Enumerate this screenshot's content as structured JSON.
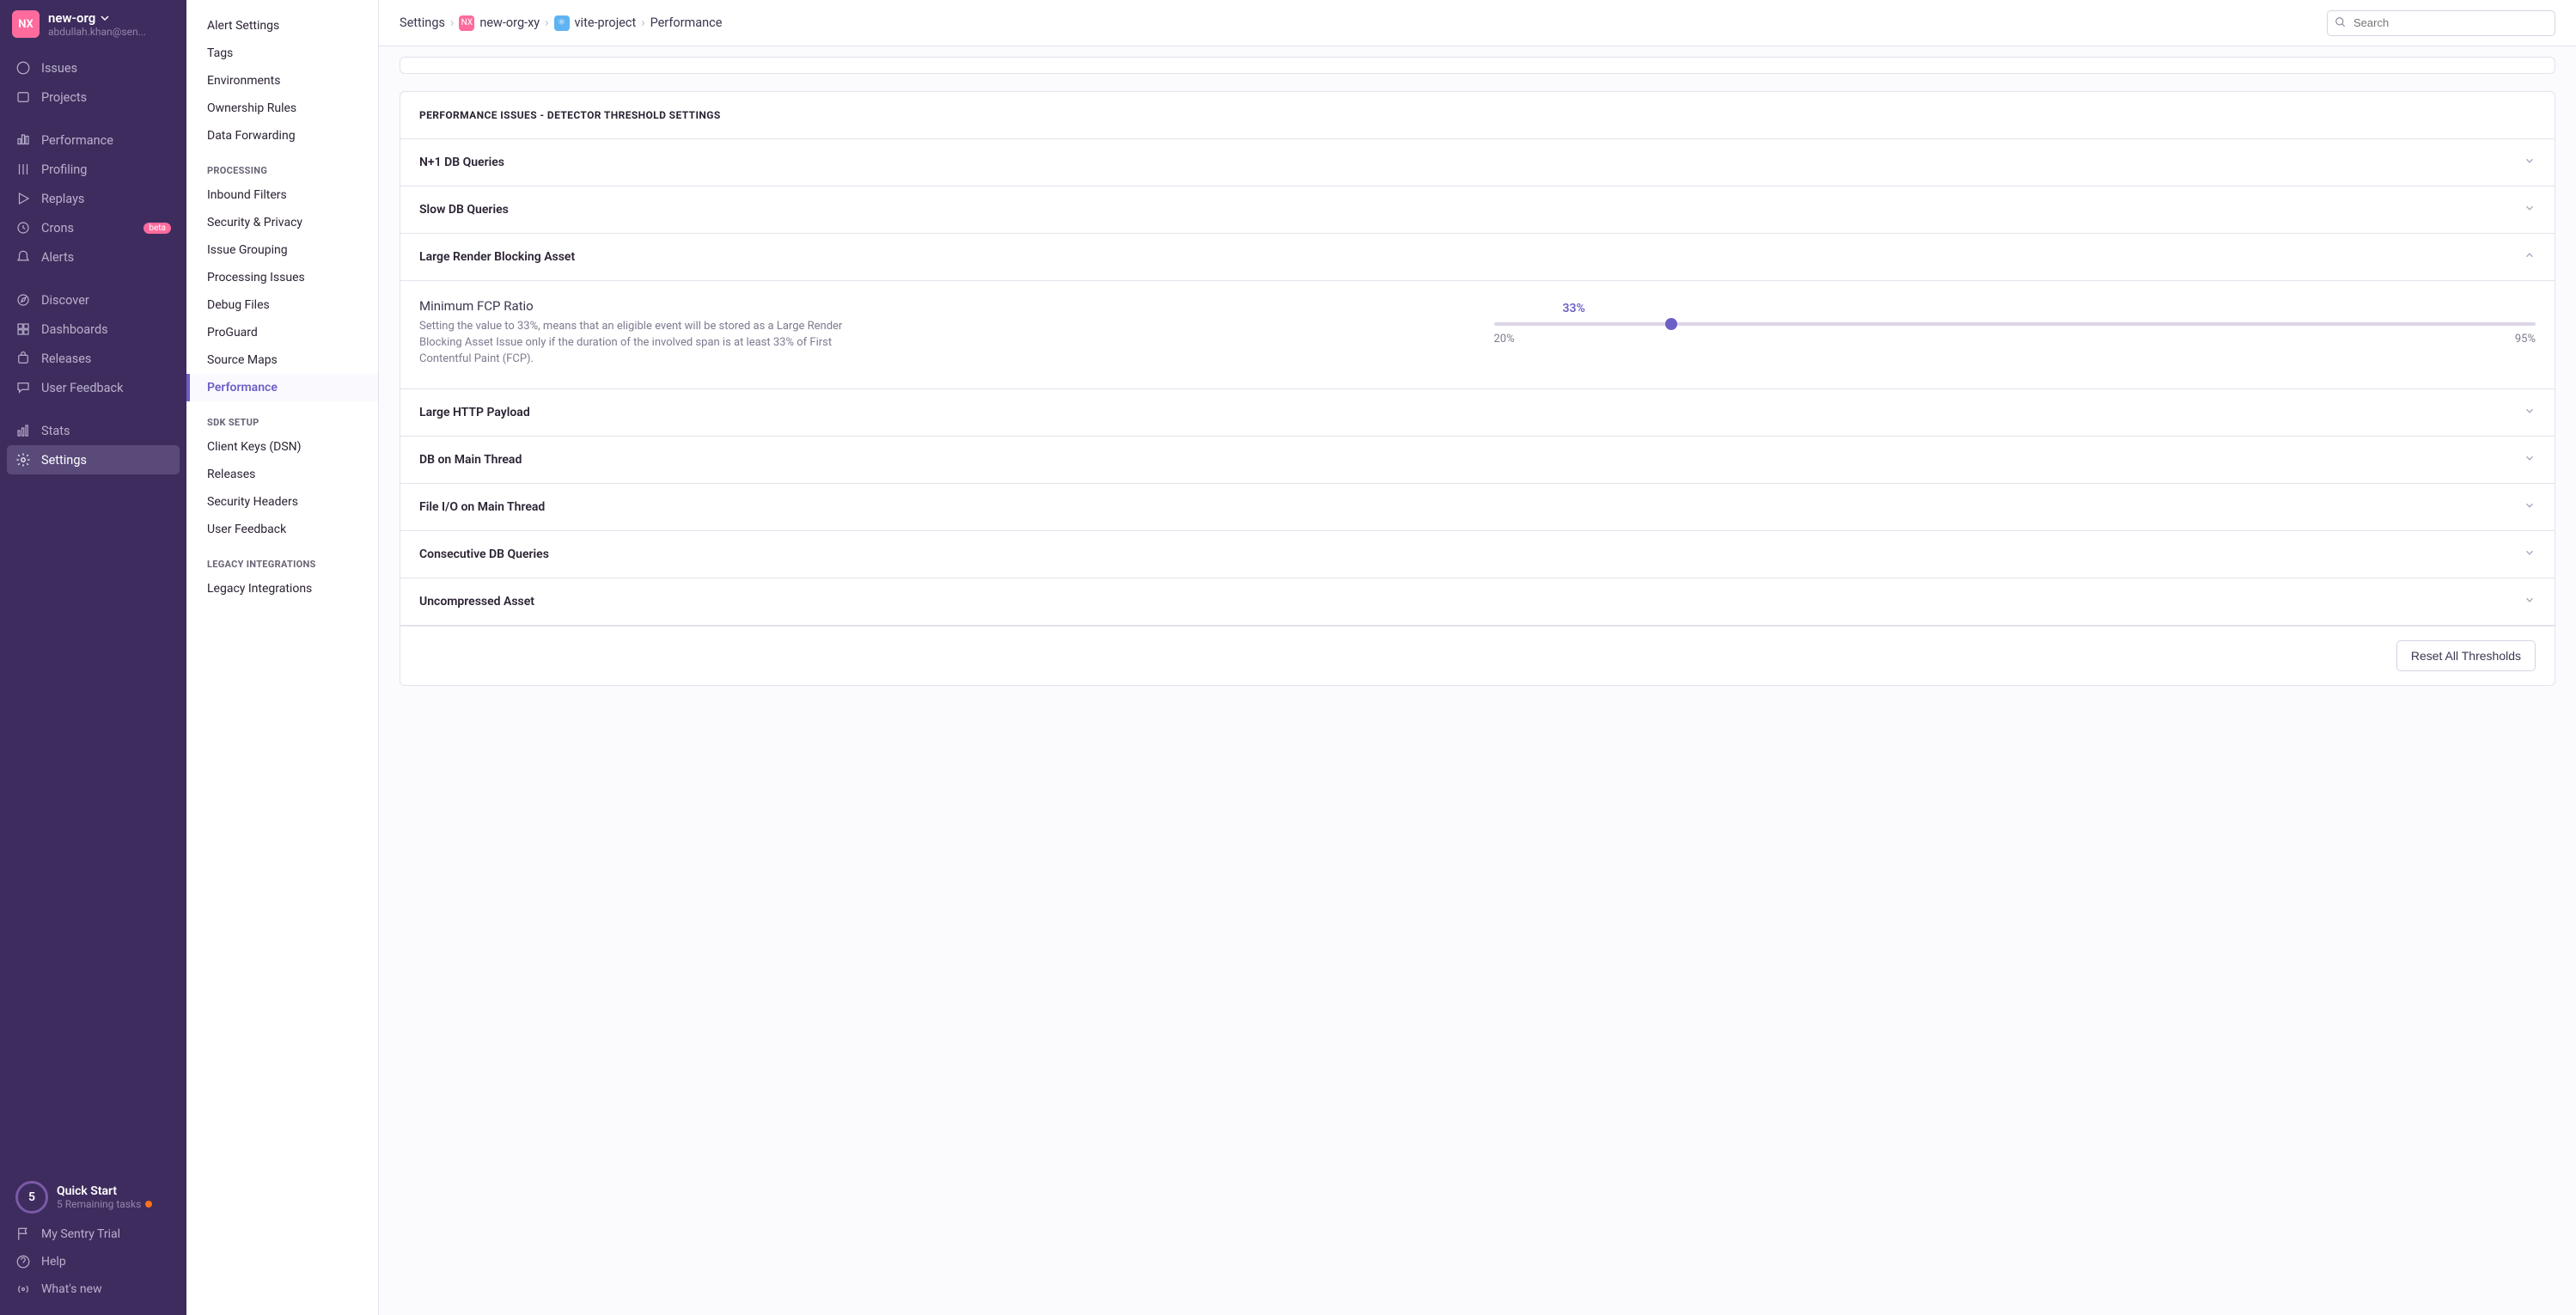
{
  "org": {
    "avatar": "NX",
    "name": "new-org",
    "email": "abdullah.khan@sen..."
  },
  "sidebar": {
    "items": [
      {
        "label": "Issues"
      },
      {
        "label": "Projects"
      },
      {
        "label": "Performance"
      },
      {
        "label": "Profiling"
      },
      {
        "label": "Replays"
      },
      {
        "label": "Crons"
      },
      {
        "label": "Alerts"
      },
      {
        "label": "Discover"
      },
      {
        "label": "Dashboards"
      },
      {
        "label": "Releases"
      },
      {
        "label": "User Feedback"
      },
      {
        "label": "Stats"
      },
      {
        "label": "Settings"
      }
    ],
    "beta": "beta",
    "quick": {
      "count": "5",
      "title": "Quick Start",
      "sub": "5 Remaining tasks"
    },
    "bottom": [
      {
        "label": "My Sentry Trial"
      },
      {
        "label": "Help"
      },
      {
        "label": "What's new"
      }
    ]
  },
  "secondary": {
    "top": [
      {
        "label": "Alert Settings"
      },
      {
        "label": "Tags"
      },
      {
        "label": "Environments"
      },
      {
        "label": "Ownership Rules"
      },
      {
        "label": "Data Forwarding"
      }
    ],
    "h1": "PROCESSING",
    "g1": [
      {
        "label": "Inbound Filters"
      },
      {
        "label": "Security & Privacy"
      },
      {
        "label": "Issue Grouping"
      },
      {
        "label": "Processing Issues"
      },
      {
        "label": "Debug Files"
      },
      {
        "label": "ProGuard"
      },
      {
        "label": "Source Maps"
      },
      {
        "label": "Performance"
      }
    ],
    "h2": "SDK SETUP",
    "g2": [
      {
        "label": "Client Keys (DSN)"
      },
      {
        "label": "Releases"
      },
      {
        "label": "Security Headers"
      },
      {
        "label": "User Feedback"
      }
    ],
    "h3": "LEGACY INTEGRATIONS",
    "g3": [
      {
        "label": "Legacy Integrations"
      }
    ]
  },
  "breadcrumb": {
    "a": "Settings",
    "b": "new-org-xy",
    "c": "vite-project",
    "d": "Performance"
  },
  "search": {
    "placeholder": "Search"
  },
  "panel": {
    "title": "PERFORMANCE ISSUES - DETECTOR THRESHOLD SETTINGS",
    "rows": [
      {
        "label": "N+1 DB Queries"
      },
      {
        "label": "Slow DB Queries"
      },
      {
        "label": "Large Render Blocking Asset"
      },
      {
        "label": "Large HTTP Payload"
      },
      {
        "label": "DB on Main Thread"
      },
      {
        "label": "File I/O on Main Thread"
      },
      {
        "label": "Consecutive DB Queries"
      },
      {
        "label": "Uncompressed Asset"
      }
    ],
    "detail": {
      "label": "Minimum FCP Ratio",
      "desc": "Setting the value to 33%, means that an eligible event will be stored as a Large Render Blocking Asset Issue only if the duration of the involved span is at least 33% of First Contentful Paint (FCP).",
      "value": "33%",
      "min": "20%",
      "max": "95%"
    },
    "reset": "Reset All Thresholds"
  }
}
